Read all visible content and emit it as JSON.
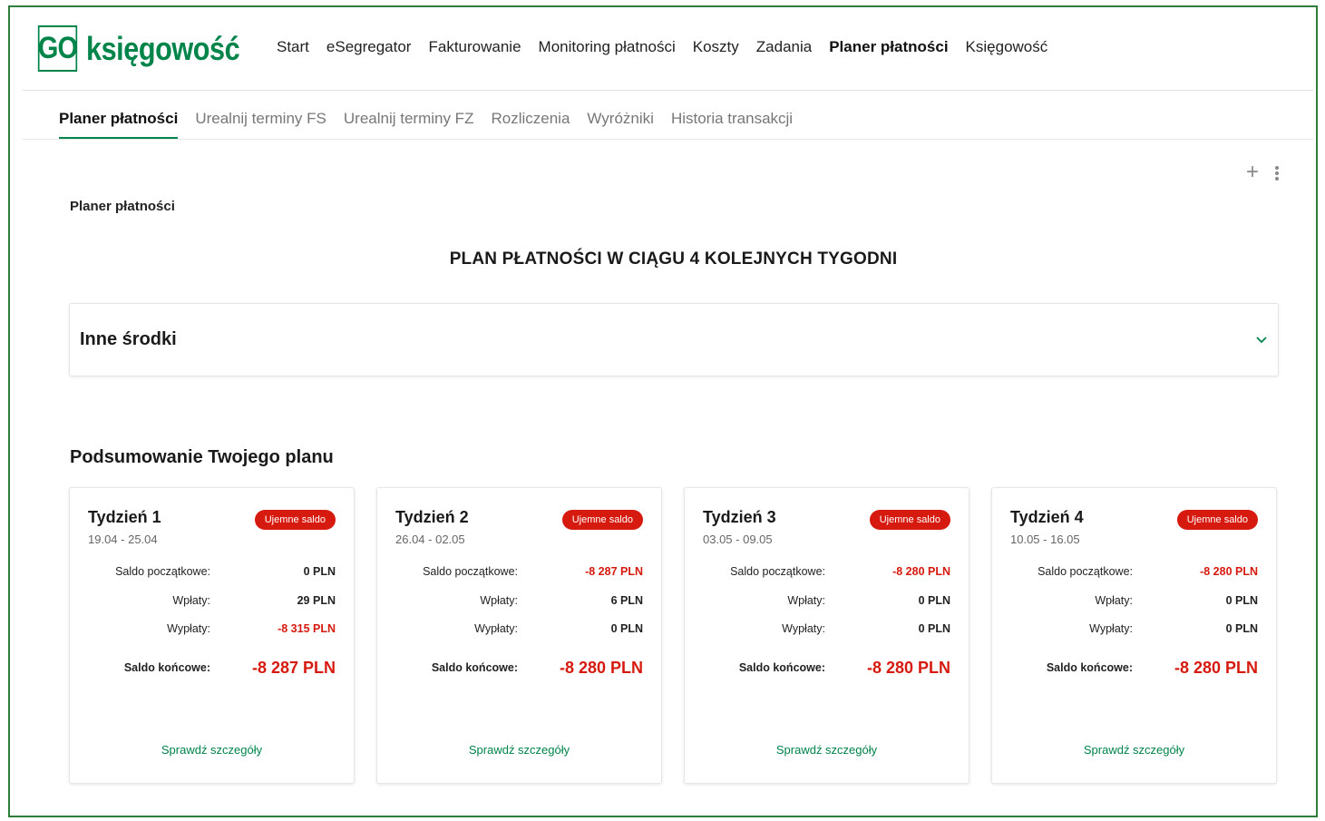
{
  "logo": {
    "box": "GO",
    "text": "księgowość"
  },
  "topnav": [
    {
      "label": "Start",
      "active": false
    },
    {
      "label": "eSegregator",
      "active": false
    },
    {
      "label": "Fakturowanie",
      "active": false
    },
    {
      "label": "Monitoring płatności",
      "active": false
    },
    {
      "label": "Koszty",
      "active": false
    },
    {
      "label": "Zadania",
      "active": false
    },
    {
      "label": "Planer płatności",
      "active": true
    },
    {
      "label": "Księgowość",
      "active": false
    }
  ],
  "subnav": [
    {
      "label": "Planer płatności",
      "active": true
    },
    {
      "label": "Urealnij terminy FS",
      "active": false
    },
    {
      "label": "Urealnij terminy FZ",
      "active": false
    },
    {
      "label": "Rozliczenia",
      "active": false
    },
    {
      "label": "Wyróżniki",
      "active": false
    },
    {
      "label": "Historia transakcji",
      "active": false
    }
  ],
  "toolbar": {
    "add_icon": "plus-icon",
    "more_icon": "kebab-icon"
  },
  "section_title": "Planer płatności",
  "plan_header": "PLAN PŁATNOŚCI W CIĄGU 4 KOLEJNYCH TYGODNI",
  "accordion": {
    "title": "Inne środki",
    "icon": "chevron-down-icon"
  },
  "summary_title": "Podsumowanie Twojego planu",
  "labels": {
    "start": "Saldo początkowe:",
    "in": "Wpłaty:",
    "out": "Wypłaty:",
    "end": "Saldo końcowe:",
    "details": "Sprawdź szczegóły"
  },
  "colors": {
    "brand": "#00844a",
    "negative": "#d61a0f"
  },
  "weeks": [
    {
      "title": "Tydzień 1",
      "dates": "19.04 - 25.04",
      "badge": "Ujemne saldo",
      "start": "0 PLN",
      "in": "29 PLN",
      "out": "-8 315 PLN",
      "end": "-8 287 PLN"
    },
    {
      "title": "Tydzień 2",
      "dates": "26.04 - 02.05",
      "badge": "Ujemne saldo",
      "start": "-8 287 PLN",
      "in": "6 PLN",
      "out": "0 PLN",
      "end": "-8 280 PLN"
    },
    {
      "title": "Tydzień 3",
      "dates": "03.05 - 09.05",
      "badge": "Ujemne saldo",
      "start": "-8 280 PLN",
      "in": "0 PLN",
      "out": "0 PLN",
      "end": "-8 280 PLN"
    },
    {
      "title": "Tydzień 4",
      "dates": "10.05 - 16.05",
      "badge": "Ujemne saldo",
      "start": "-8 280 PLN",
      "in": "0 PLN",
      "out": "0 PLN",
      "end": "-8 280 PLN"
    }
  ]
}
